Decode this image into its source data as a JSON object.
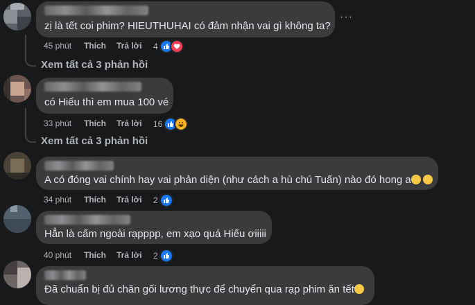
{
  "comments": [
    {
      "text": "zị là tết coi phim? HIEUTHUHAI có đảm nhận vai gì không ta?",
      "time": "45 phút",
      "like": "Thích",
      "reply": "Trả lời",
      "reaction_count": "4",
      "reaction_icons": [
        "like-icon",
        "love-icon"
      ],
      "view_replies": "Xem tất cả 3 phản hồi"
    },
    {
      "text": "có Hiếu thì em mua 100 vé",
      "time": "33 phút",
      "like": "Thích",
      "reply": "Trả lời",
      "reaction_count": "16",
      "reaction_icons": [
        "like-icon",
        "haha-icon"
      ],
      "view_replies": "Xem tất cả 3 phản hồi"
    },
    {
      "text": "A có đóng vai chính hay vai phản diện (như cách a hù chú Tuấn) nào đó hong a",
      "time": "34 phút",
      "like": "Thích",
      "reply": "Trả lời",
      "reaction_count": "2",
      "reaction_icons": [
        "like-icon"
      ]
    },
    {
      "text": "Hẳn là cấm ngoài rạpppp, em xạo quá Hiếu ơiiiii",
      "time": "40 phút",
      "like": "Thích",
      "reply": "Trả lời",
      "reaction_count": "2",
      "reaction_icons": [
        "like-icon"
      ]
    },
    {
      "text": "Đã chuẩn bị đủ chăn gối lương thực để chuyển qua rạp phim ăn tết"
    }
  ],
  "more_options": "···",
  "colors": {
    "background": "#18191a",
    "bubble": "#3a3b3c",
    "text": "#e4e6eb",
    "muted": "#b0b3b8",
    "like": "#1877f2",
    "love": "#f33e58"
  }
}
